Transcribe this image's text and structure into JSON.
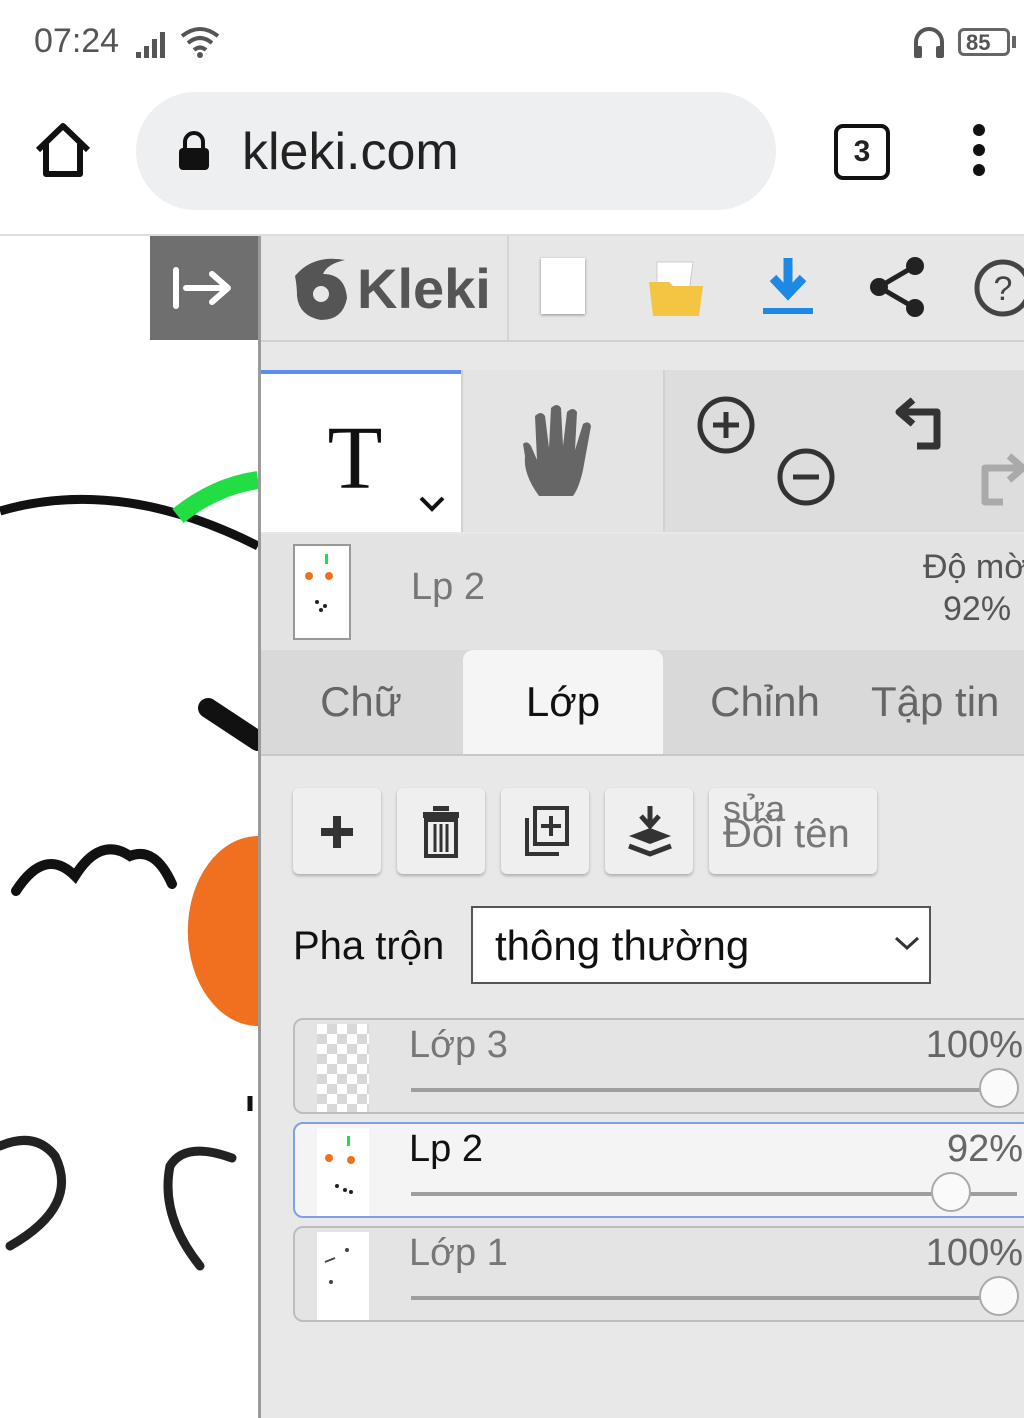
{
  "status_bar": {
    "time": "07:24",
    "battery": "85"
  },
  "browser": {
    "url": "kleki.com",
    "tab_count": "3"
  },
  "app": {
    "logo": "Kleki",
    "current_layer": {
      "name": "Lp 2",
      "opacity_label": "Độ mờ",
      "opacity": "92%"
    },
    "tabs": [
      {
        "label": "Chữ",
        "active": false
      },
      {
        "label": "Lớp",
        "active": true
      },
      {
        "label": "Chỉnh",
        "active": false
      },
      {
        "label": "Tập tin",
        "active": false
      }
    ],
    "layer_actions": {
      "rename_top": "sửa",
      "rename_label": "Đổi tên"
    },
    "blend": {
      "label": "Pha trộn",
      "value": "thông thường"
    },
    "layers": [
      {
        "name": "Lớp 3",
        "opacity": "100%",
        "level": 1.0,
        "selected": false
      },
      {
        "name": "Lp 2",
        "opacity": "92%",
        "level": 0.92,
        "selected": true
      },
      {
        "name": "Lớp 1",
        "opacity": "100%",
        "level": 1.0,
        "selected": false
      }
    ]
  },
  "colors": {
    "accent": "#5b8ef0",
    "download": "#1e88e5",
    "folder": "#f4c542",
    "canvas_orange": "#f07020",
    "canvas_green": "#22dd44"
  }
}
